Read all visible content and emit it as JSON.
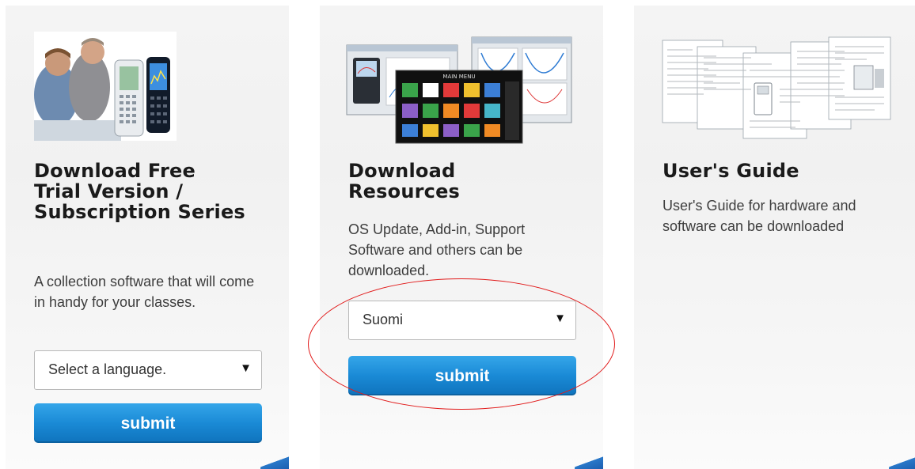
{
  "cards": [
    {
      "title": "Download Free Trial Version / Subscription Series",
      "description": "A collection software that will come in handy for your classes.",
      "select": {
        "selected": "Select a language."
      },
      "submit_label": "submit"
    },
    {
      "title": "Download Resources",
      "description": "OS Update, Add-in, Support Software and others can be downloaded.",
      "select": {
        "selected": "Suomi"
      },
      "submit_label": "submit",
      "screenshot": {
        "menu_title": "MAIN MENU"
      }
    },
    {
      "title": "User's Guide",
      "description": "User's Guide for hardware and software can be downloaded"
    }
  ],
  "icons": {
    "dropdown_arrow": "▼"
  },
  "colors": {
    "button": "#1a8ad6",
    "highlight": "#e11b1b",
    "corner_accent": "#2a78c9"
  }
}
